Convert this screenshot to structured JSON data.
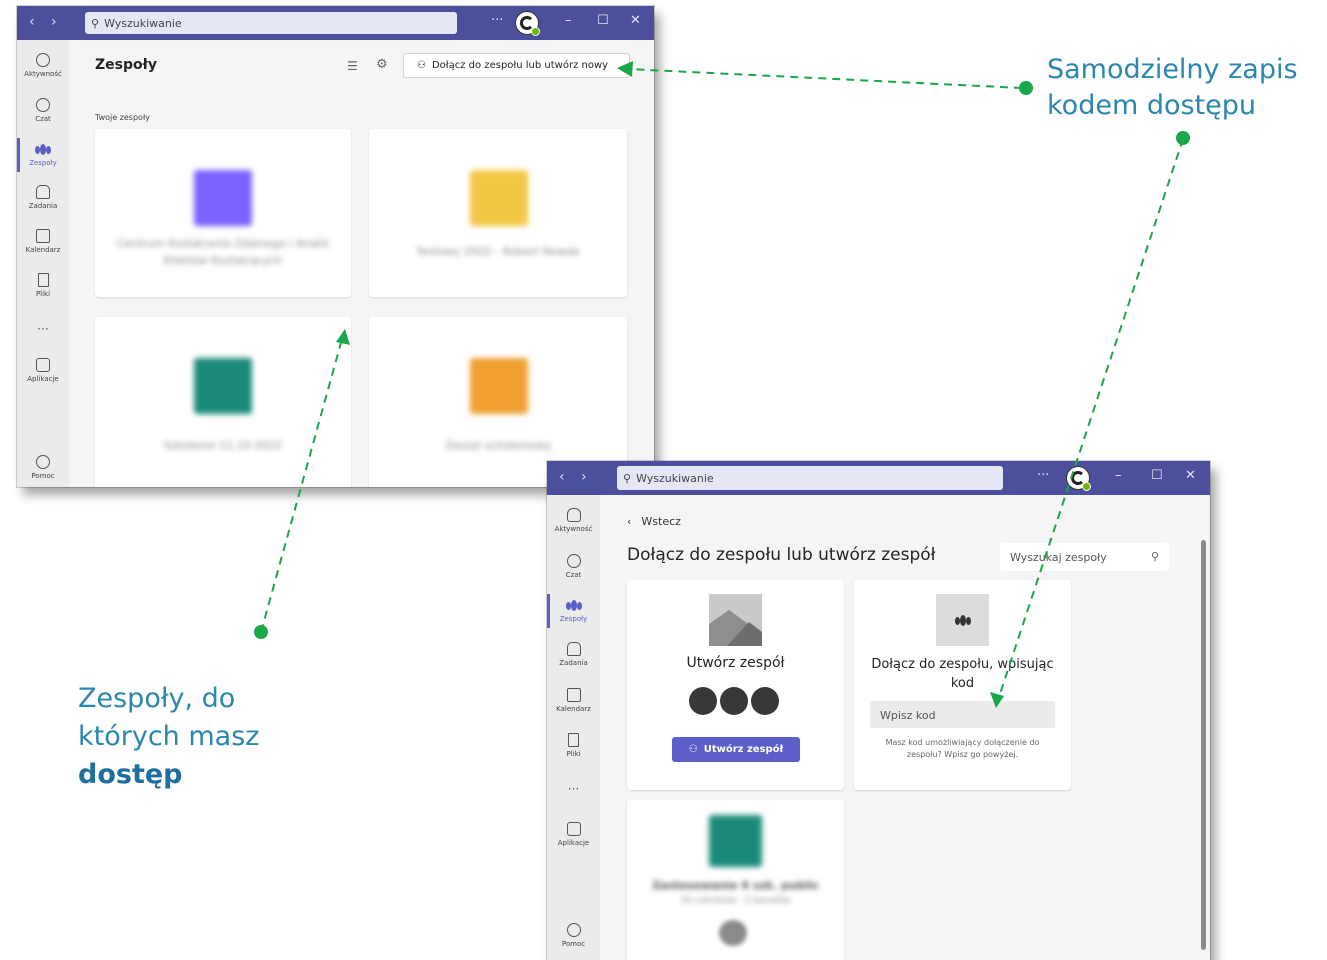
{
  "colors": {
    "titlebar": "#4b4f9c",
    "accent": "#5b5fc7",
    "annotation_text": "#2b86b0",
    "arrow_green": "#1aa64a"
  },
  "window1": {
    "search_placeholder": "Wyszukiwanie",
    "more": "···",
    "page_title": "Zespoły",
    "join_button_label": "Dołącz do zespołu lub utwórz nowy",
    "section_label": "Twoje zespoły",
    "teams": [
      {
        "name": "Centrum Kształcenia Zdalnego i Analiz Efektów Kształcących",
        "logo_color": "#7b61ff"
      },
      {
        "name": "Testowy 2022 - Robert Nowak",
        "logo_color": "#f2c744"
      },
      {
        "name": "Szkolenie 11.10.2022",
        "logo_color": "#1a8a7a"
      },
      {
        "name": "Zeszyt uchdomowy",
        "logo_color": "#f0a030"
      }
    ]
  },
  "rail": {
    "items": [
      {
        "label": "Aktywność",
        "icon": "bell-icon"
      },
      {
        "label": "Czat",
        "icon": "chat-icon"
      },
      {
        "label": "Zespoły",
        "icon": "teams-icon"
      },
      {
        "label": "Zadania",
        "icon": "backpack-icon"
      },
      {
        "label": "Kalendarz",
        "icon": "calendar-icon"
      },
      {
        "label": "Pliki",
        "icon": "file-icon"
      },
      {
        "label": "···",
        "icon": "more-icon"
      },
      {
        "label": "Aplikacje",
        "icon": "apps-icon"
      },
      {
        "label": "Pomoc",
        "icon": "help-icon"
      }
    ]
  },
  "window2": {
    "search_placeholder": "Wyszukiwanie",
    "more": "···",
    "back_label": "Wstecz",
    "page_title": "Dołącz do zespołu lub utwórz zespół",
    "search_teams_placeholder": "Wyszukaj zespoły",
    "create_card": {
      "title": "Utwórz zespół",
      "button_label": "Utwórz zespół"
    },
    "join_card": {
      "title": "Dołącz do zespołu, wpisując kod",
      "input_placeholder": "Wpisz kod",
      "hint": "Masz kod umożliwiający dołączenie do zespołu? Wpisz go powyżej."
    },
    "suggested_team": {
      "name": "Zastosowanie 6 szk. public",
      "meta": "30 członków · 2 kanałów",
      "logo_color": "#1a8a7a"
    }
  },
  "annotations": {
    "code_access": "Samodzielny zapis kodem dostępu",
    "teams_access_prefix": "Zespoły, do których masz",
    "teams_access_bold": "dostęp"
  }
}
